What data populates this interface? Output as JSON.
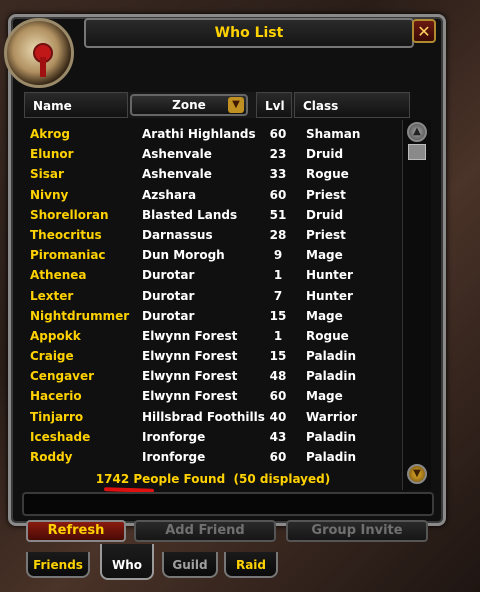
{
  "window": {
    "title": "Who List",
    "close_icon": "close-icon"
  },
  "columns": {
    "name": "Name",
    "zone": "Zone",
    "level": "Lvl",
    "class": "Class"
  },
  "players": [
    {
      "name": "Akrog",
      "zone": "Arathi Highlands",
      "level": "60",
      "class": "Shaman"
    },
    {
      "name": "Elunor",
      "zone": "Ashenvale",
      "level": "23",
      "class": "Druid"
    },
    {
      "name": "Sisar",
      "zone": "Ashenvale",
      "level": "33",
      "class": "Rogue"
    },
    {
      "name": "Nivny",
      "zone": "Azshara",
      "level": "60",
      "class": "Priest"
    },
    {
      "name": "Shorelloran",
      "zone": "Blasted Lands",
      "level": "51",
      "class": "Druid"
    },
    {
      "name": "Theocritus",
      "zone": "Darnassus",
      "level": "28",
      "class": "Priest"
    },
    {
      "name": "Piromaniac",
      "zone": "Dun Morogh",
      "level": "9",
      "class": "Mage"
    },
    {
      "name": "Athenea",
      "zone": "Durotar",
      "level": "1",
      "class": "Hunter"
    },
    {
      "name": "Lexter",
      "zone": "Durotar",
      "level": "7",
      "class": "Hunter"
    },
    {
      "name": "Nightdrummer",
      "zone": "Durotar",
      "level": "15",
      "class": "Mage"
    },
    {
      "name": "Appokk",
      "zone": "Elwynn Forest",
      "level": "1",
      "class": "Rogue"
    },
    {
      "name": "Craige",
      "zone": "Elwynn Forest",
      "level": "15",
      "class": "Paladin"
    },
    {
      "name": "Cengaver",
      "zone": "Elwynn Forest",
      "level": "48",
      "class": "Paladin"
    },
    {
      "name": "Hacerio",
      "zone": "Elwynn Forest",
      "level": "60",
      "class": "Mage"
    },
    {
      "name": "Tinjarro",
      "zone": "Hillsbrad Foothills",
      "level": "40",
      "class": "Warrior"
    },
    {
      "name": "Iceshade",
      "zone": "Ironforge",
      "level": "43",
      "class": "Paladin"
    },
    {
      "name": "Roddy",
      "zone": "Ironforge",
      "level": "60",
      "class": "Paladin"
    }
  ],
  "status": {
    "found_text": "1742 People Found  (50 displayed)"
  },
  "buttons": {
    "refresh": "Refresh",
    "add_friend": "Add Friend",
    "group_invite": "Group Invite"
  },
  "tabs": [
    {
      "label": "Friends"
    },
    {
      "label": "Who",
      "selected": true
    },
    {
      "label": "Guild"
    },
    {
      "label": "Raid"
    }
  ],
  "colors": {
    "name_text": "#ffd200",
    "title_text": "#ffd200",
    "annotation_underline": "#e01010"
  }
}
